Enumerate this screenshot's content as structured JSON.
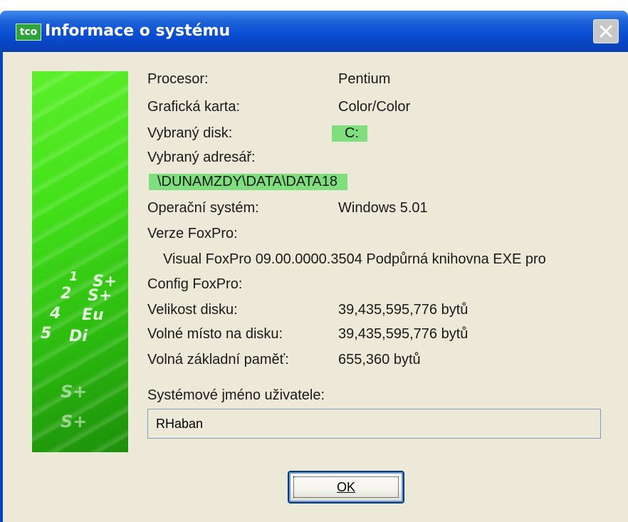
{
  "window": {
    "title": "Informace o systému",
    "app_icon_text": "tco",
    "titlebar_color": "#0a4fd4",
    "close_icon": "close-icon"
  },
  "side_image": {
    "glyphs": [
      "1",
      "S+",
      "2",
      "S+",
      "4",
      "Eu",
      "5",
      "Di",
      "S+",
      "S+"
    ]
  },
  "info": {
    "processor_label": "Procesor:",
    "processor_value": "Pentium",
    "graphics_label": "Grafická karta:",
    "graphics_value": "Color/Color",
    "disk_label": "Vybraný disk:",
    "disk_value": "C:",
    "dir_label": "Vybraný adresář:",
    "dir_value": "\\DUNAMZDY\\DATA\\DATA18",
    "os_label": "Operační systém:",
    "os_value": "Windows 5.01",
    "foxpro_version_label": "Verze FoxPro:",
    "foxpro_version_value": "Visual FoxPro 09.00.0000.3504 Podpůrná knihovna EXE  pro",
    "config_label": "Config FoxPro:",
    "disk_size_label": "Velikost disku:",
    "disk_size_value": "39,435,595,776 bytů",
    "free_disk_label": "Volné místo na disku:",
    "free_disk_value": "39,435,595,776 bytů",
    "free_mem_label": "Volná základní paměť:",
    "free_mem_value": "655,360 bytů",
    "username_label": "Systémové jméno uživatele:",
    "username_value": "RHaban",
    "highlight_color": "#7fdf7f"
  },
  "buttons": {
    "ok_label": "OK"
  }
}
